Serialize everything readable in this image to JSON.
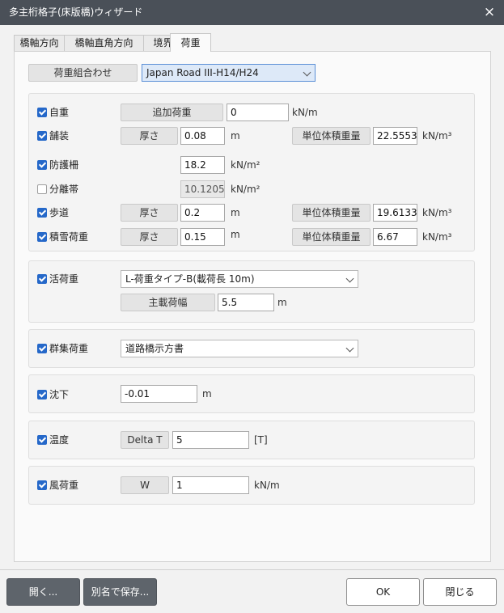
{
  "window": {
    "title": "多主桁格子(床版橋)ウィザード",
    "close_icon": "×"
  },
  "tabs": [
    "橋軸方向",
    "橋軸直角方向",
    "境界",
    "荷重"
  ],
  "combination": {
    "label": "荷重組合わせ",
    "selected": "Japan Road III-H14/H24"
  },
  "dead": {
    "self": {
      "label": "自重",
      "button": "追加荷重",
      "value": "0",
      "unit": "kN/m"
    },
    "pavement": {
      "label": "舗装",
      "button": "厚さ",
      "value": "0.08",
      "unit": "m",
      "uw_button": "単位体積重量",
      "uw_value": "22.5553",
      "uw_unit": "kN/m³"
    },
    "barrier": {
      "label": "防護柵",
      "value": "18.2",
      "unit": "kN/m²"
    },
    "median": {
      "label": "分離帯",
      "value": "10.1205",
      "unit": "kN/m²"
    },
    "sidewalk": {
      "label": "歩道",
      "button": "厚さ",
      "value": "0.2",
      "unit": "m",
      "uw_button": "単位体積重量",
      "uw_value": "19.6133",
      "uw_unit": "kN/m³"
    },
    "snow": {
      "label": "積雪荷重",
      "button": "厚さ",
      "value": "0.15",
      "unit": "m",
      "uw_button": "単位体積重量",
      "uw_value": "6.67",
      "uw_unit": "kN/m³"
    }
  },
  "live": {
    "label": "活荷重",
    "selected": "L-荷重タイプ-B(載荷長 10m)",
    "width_button": "主載荷幅",
    "width_value": "5.5",
    "width_unit": "m"
  },
  "crowd": {
    "label": "群集荷重",
    "selected": "道路橋示方書"
  },
  "settlement": {
    "label": "沈下",
    "value": "-0.01",
    "unit": "m"
  },
  "temperature": {
    "label": "温度",
    "button": "Delta T",
    "value": "5",
    "unit": "[T]"
  },
  "wind": {
    "label": "風荷重",
    "button": "W",
    "value": "1",
    "unit": "kN/m"
  },
  "footer": {
    "open": "開く...",
    "save_as": "別名で保存...",
    "ok": "OK",
    "close": "閉じる"
  }
}
